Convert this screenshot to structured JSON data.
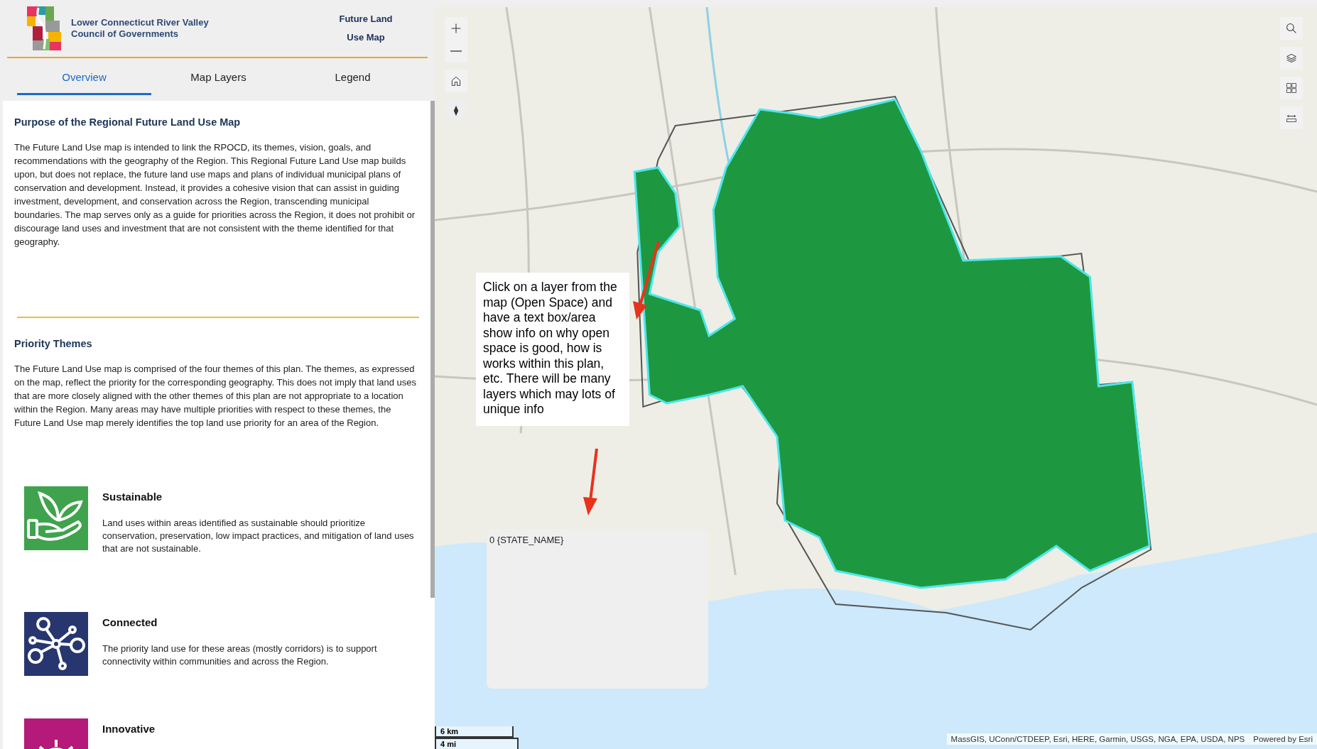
{
  "header": {
    "org_name": "Lower Connecticut River Valley Council of Governments",
    "app_title": "Future Land Use Map"
  },
  "tabs": [
    {
      "label": "Overview",
      "selected": true
    },
    {
      "label": "Map Layers",
      "selected": false
    },
    {
      "label": "Legend",
      "selected": false
    }
  ],
  "sections": [
    {
      "heading": "Purpose of the Regional Future Land Use Map",
      "text": "The Future Land Use map is intended to link the RPOCD, its themes, vision, goals, and recommendations with the geography of the Region. This Regional Future Land Use map builds upon, but does not replace, the future land use maps and plans of individual municipal plans of conservation and development. Instead, it provides a cohesive vision that can assist in guiding investment, development, and conservation across the Region, transcending municipal boundaries. The map serves only as a guide for priorities across the Region, it does not prohibit or discourage land uses and investment that are not consistent with the theme identified for that geography."
    },
    {
      "heading": "Priority Themes",
      "text": "The Future Land Use map is comprised of the four themes of this plan. The themes, as expressed on the map, reflect the priority for the corresponding geography. This does not imply that land uses that are more closely aligned with the other themes of this plan are not appropriate to a location within the Region. Many areas may have multiple priorities with respect to these themes, the Future Land Use map merely identifies the top land use priority for an area of the Region."
    }
  ],
  "themes": [
    {
      "kind": "sustainable",
      "color": "#3fa34d",
      "title": "Sustainable",
      "text": "Land uses within areas identified as sustainable should prioritize conservation, preservation, low impact practices, and mitigation of land uses that are not sustainable."
    },
    {
      "kind": "connected",
      "color": "#27366f",
      "title": "Connected",
      "text": "The priority land use for these areas (mostly corridors) is to support connectivity within communities and across the Region."
    },
    {
      "kind": "innovative",
      "color": "#b5197a",
      "title": "Innovative"
    }
  ],
  "map": {
    "note": "Click on a layer from the map (Open Space) and have a text box/area show info on why open space is good, how is works within this plan, etc. There will be many layers which may lots of unique info",
    "popup": "0 {STATE_NAME}",
    "scale": [
      "6 km",
      "4 mi"
    ],
    "attribution": "MassGIS, UConn/CTDEEP, Esri, HERE, Garmin, USGS, NGA, EPA, USDA, NPS",
    "powered_by": "Powered by Esri"
  }
}
